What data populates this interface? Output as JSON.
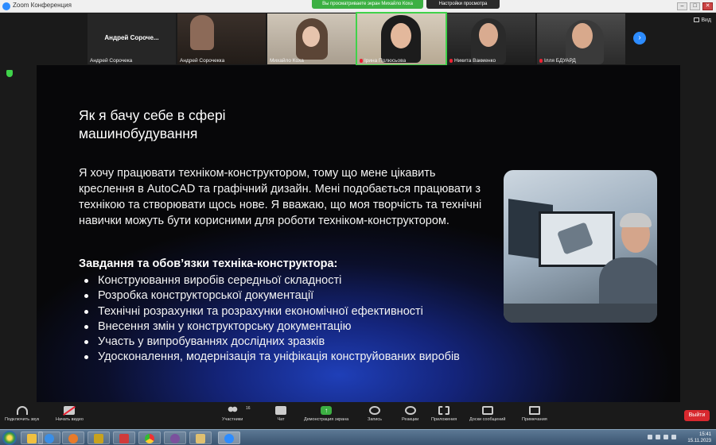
{
  "window": {
    "title": "Zoom Конференция",
    "share_banner": "Вы просматриваете экран Михайло Коха",
    "share_settings": "Настройки просмотра",
    "view_label": "Вид",
    "controls": [
      "–",
      "□",
      "✕"
    ]
  },
  "participants": [
    {
      "name": "Андрей Сорочекa",
      "center_name": "Андрей Сороче...",
      "video": false,
      "muted": false
    },
    {
      "name": "Андрей Сорочекка",
      "video": true,
      "muted": false
    },
    {
      "name": "Михайло Коха",
      "video": true,
      "muted": false
    },
    {
      "name": "Ірина Полюсьова",
      "video": true,
      "muted": true,
      "active_speaker": true
    },
    {
      "name": "Никита Вакменко",
      "video": true,
      "muted": true
    },
    {
      "name": "Ілля БДУАРД",
      "video": true,
      "muted": true
    }
  ],
  "slide": {
    "title": "Як я бачу себе в сфері машинобудування",
    "paragraph": "Я хочу працювати техніком-конструктором, тому що мене цікавить креслення в AutoCAD та графічний дизайн. Мені подобається працювати з технікою та створювати щось нове. Я вважаю, що моя творчість та технічні навички можуть бути корисними для роботи техніком-конструктором.",
    "duties_heading": "Завдання та обов’язки техніка-конструктора:",
    "duties": [
      "Конструювання виробів середньої складності",
      "Розробка конструкторської документації",
      "Технічні розрахунки та розрахунки економічної ефективності",
      "Внесення змін у конструкторську документацію",
      "Участь у випробуваннях дослідних зразків",
      "Удосконалення, модернізація та уніфікація конструйованих виробів"
    ]
  },
  "toolbar": {
    "audio": "Подключить звук",
    "video": "Начать видео",
    "participants": "Участники",
    "participants_count": "16",
    "chat": "Чат",
    "share": "Демонстрация экрана",
    "record": "Запись",
    "reactions": "Реакции",
    "apps": "Приложения",
    "whiteboard": "Доски сообщений",
    "notes": "Примечания",
    "leave": "Выйти"
  },
  "taskbar": {
    "time": "15:41",
    "date": "15.11.2023"
  },
  "colors": {
    "accent": "#2d8cff",
    "share_green": "#3cb043",
    "leave_red": "#d8282e",
    "slide_bg": "#0b0f2b"
  }
}
